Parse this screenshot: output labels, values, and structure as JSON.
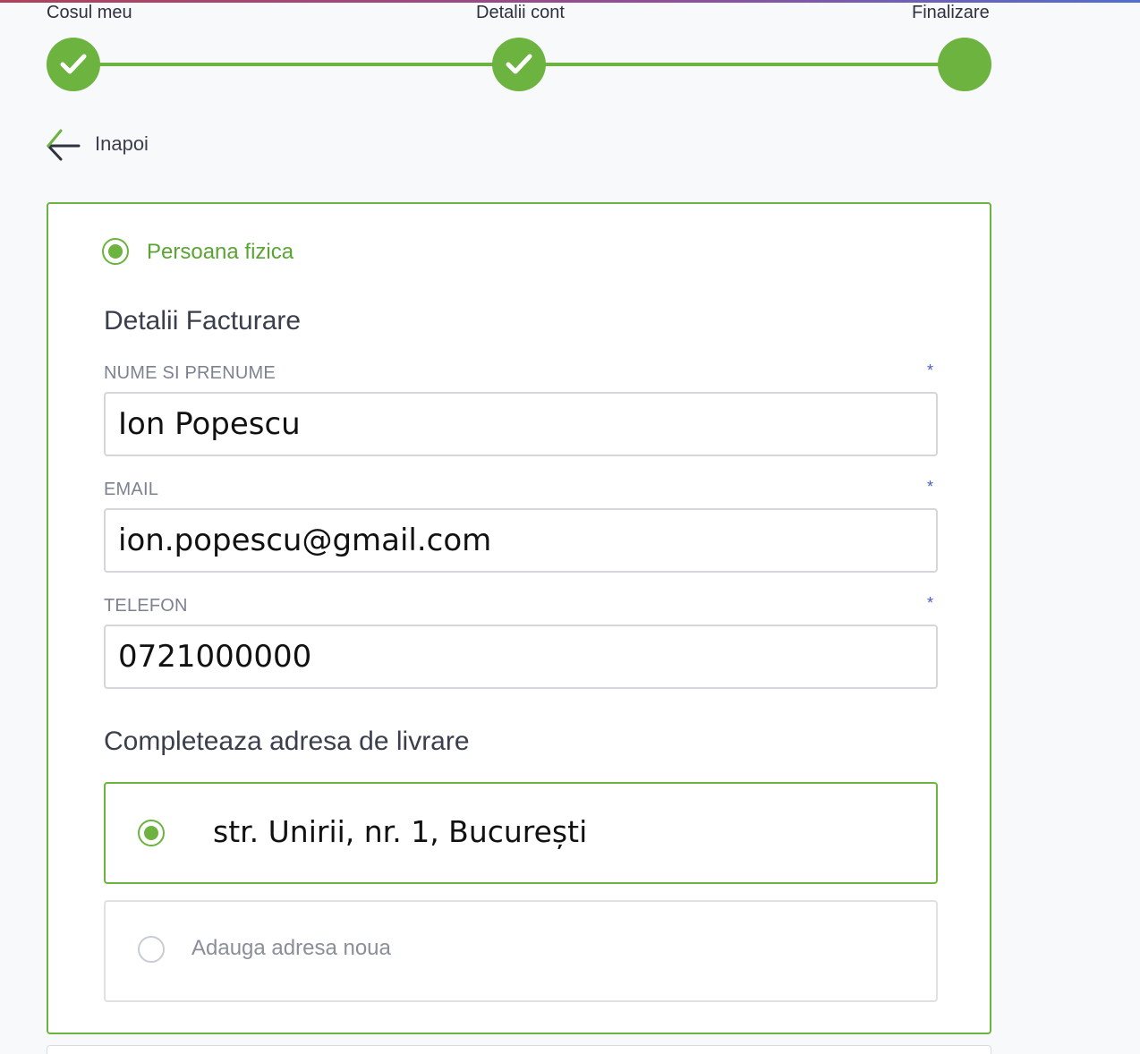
{
  "stepper": {
    "steps": [
      {
        "label": "Cosul meu",
        "state": "done"
      },
      {
        "label": "Detalii cont",
        "state": "done"
      },
      {
        "label": "Finalizare",
        "state": "current"
      }
    ],
    "accent_color": "#6cb33f"
  },
  "back": {
    "label": "Inapoi",
    "icon": "arrow-left-icon"
  },
  "form": {
    "person_type": {
      "label": "Persoana fizica",
      "selected": true
    },
    "billing_title": "Detalii Facturare",
    "fields": {
      "name": {
        "label": "NUME SI PRENUME",
        "required_mark": "*",
        "value": "Ion Popescu"
      },
      "email": {
        "label": "EMAIL",
        "required_mark": "*",
        "value": "ion.popescu@gmail.com"
      },
      "phone": {
        "label": "TELEFON",
        "required_mark": "*",
        "value": "0721000000"
      }
    },
    "delivery_title": "Completeaza adresa de livrare",
    "addresses": {
      "existing": {
        "text": "str. Unirii, nr. 1, București",
        "selected": true
      },
      "new": {
        "text": "Adauga adresa noua",
        "selected": false
      }
    }
  }
}
